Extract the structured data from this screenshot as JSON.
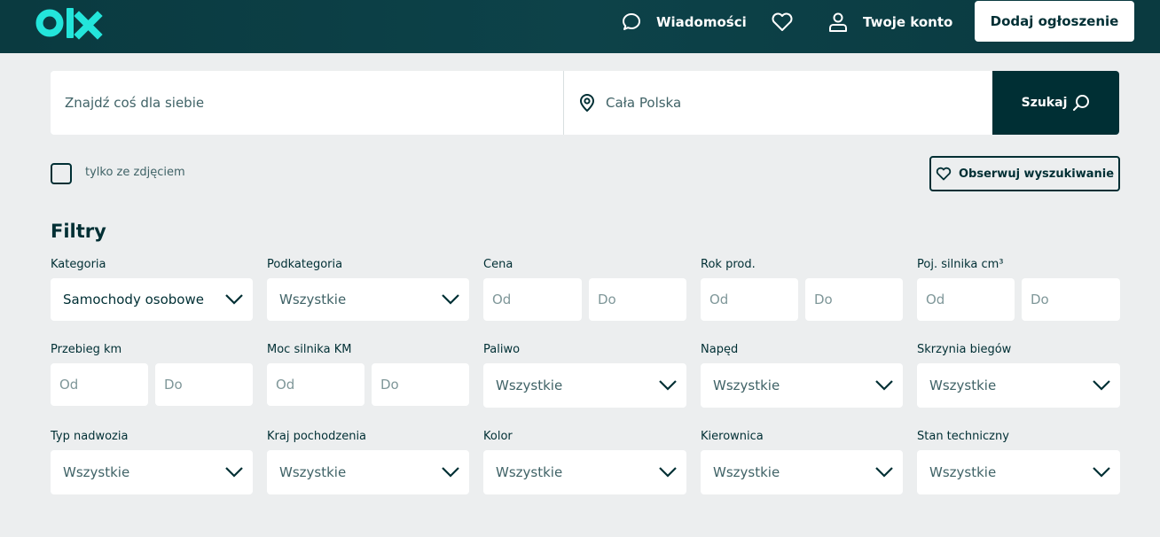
{
  "header": {
    "logo_text": "olx",
    "messages_label": "Wiadomości",
    "account_label": "Twoje konto",
    "add_ad_label": "Dodaj ogłoszenie"
  },
  "search": {
    "query_placeholder": "Znajdź coś dla siebie",
    "location_placeholder": "Cała Polska",
    "button_label": "Szukaj"
  },
  "photo_filter": {
    "label": "tylko ze zdjęciem",
    "checked": false
  },
  "observe_button": "Obserwuj wyszukiwanie",
  "filters": {
    "title": "Filtry",
    "category": {
      "label": "Kategoria",
      "value": "Samochody osobowe"
    },
    "subcategory": {
      "label": "Podkategoria",
      "value": "Wszystkie"
    },
    "price": {
      "label": "Cena",
      "from": "Od",
      "to": "Do"
    },
    "year": {
      "label": "Rok prod.",
      "from": "Od",
      "to": "Do"
    },
    "engine_capacity": {
      "label": "Poj. silnika cm³",
      "from": "Od",
      "to": "Do"
    },
    "mileage": {
      "label": "Przebieg km",
      "from": "Od",
      "to": "Do"
    },
    "engine_power": {
      "label": "Moc silnika KM",
      "from": "Od",
      "to": "Do"
    },
    "fuel": {
      "label": "Paliwo",
      "value": "Wszystkie"
    },
    "drive": {
      "label": "Napęd",
      "value": "Wszystkie"
    },
    "gearbox": {
      "label": "Skrzynia biegów",
      "value": "Wszystkie"
    },
    "body_type": {
      "label": "Typ nadwozia",
      "value": "Wszystkie"
    },
    "origin_country": {
      "label": "Kraj pochodzenia",
      "value": "Wszystkie"
    },
    "color": {
      "label": "Kolor",
      "value": "Wszystkie"
    },
    "steering": {
      "label": "Kierownica",
      "value": "Wszystkie"
    },
    "condition": {
      "label": "Stan techniczny",
      "value": "Wszystkie"
    }
  },
  "colors": {
    "header_bg": "#0b3d44",
    "brand_teal": "#23e5db",
    "primary_dark": "#002f34",
    "page_bg": "#eceeef"
  },
  "icons": [
    "message-icon",
    "heart-icon",
    "user-icon",
    "location-pin-icon",
    "search-icon",
    "chevron-down-icon"
  ]
}
